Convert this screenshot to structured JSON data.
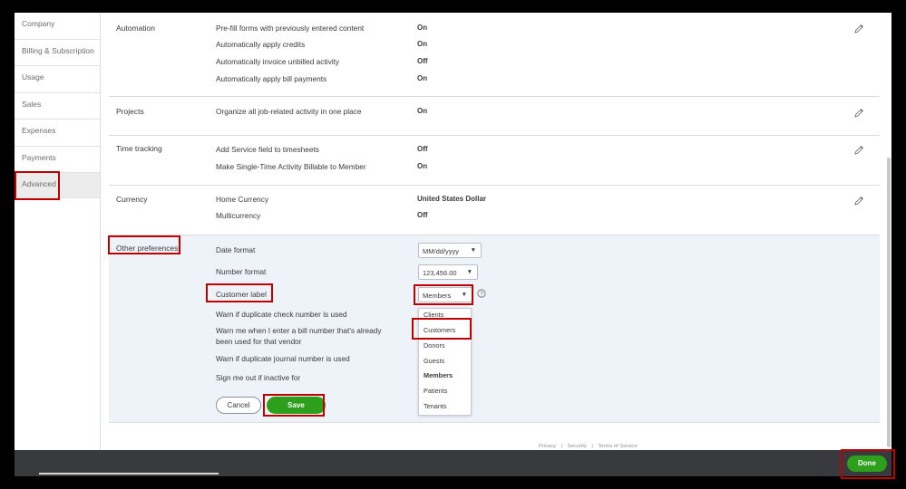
{
  "sidebar": {
    "items": [
      {
        "label": "Company"
      },
      {
        "label": "Billing & Subscription"
      },
      {
        "label": "Usage"
      },
      {
        "label": "Sales"
      },
      {
        "label": "Expenses"
      },
      {
        "label": "Payments"
      },
      {
        "label": "Advanced"
      }
    ],
    "active": "Advanced"
  },
  "sections": {
    "automation": {
      "label": "Automation",
      "rows": [
        {
          "label": "Pre-fill forms with previously entered content",
          "value": "On"
        },
        {
          "label": "Automatically apply credits",
          "value": "On"
        },
        {
          "label": "Automatically invoice unbilled activity",
          "value": "Off"
        },
        {
          "label": "Automatically apply bill payments",
          "value": "On"
        }
      ]
    },
    "projects": {
      "label": "Projects",
      "rows": [
        {
          "label": "Organize all job-related activity in one place",
          "value": "On"
        }
      ]
    },
    "time_tracking": {
      "label": "Time tracking",
      "rows": [
        {
          "label": "Add Service field to timesheets",
          "value": "Off"
        },
        {
          "label": "Make Single-Time Activity Billable to Member",
          "value": "On"
        }
      ]
    },
    "currency": {
      "label": "Currency",
      "rows": [
        {
          "label": "Home Currency",
          "value": "United States Dollar"
        },
        {
          "label": "Multicurrency",
          "value": "Off"
        }
      ]
    },
    "other": {
      "label": "Other preferences",
      "date_format_label": "Date format",
      "date_format_value": "MM/dd/yyyy",
      "number_format_label": "Number format",
      "number_format_value": "123,456.00",
      "customer_label_label": "Customer label",
      "customer_label_value": "Members",
      "warn_check": "Warn if duplicate check number is used",
      "warn_bill_line1": "Warn me when I enter a bill number that's already",
      "warn_bill_line2": "been used for that vendor",
      "warn_journal": "Warn if duplicate journal number is used",
      "sign_out": "Sign me out if inactive for",
      "dropdown_options": [
        "Clients",
        "Customers",
        "Donors",
        "Guests",
        "Members",
        "Patients",
        "Tenants"
      ],
      "cancel": "Cancel",
      "save": "Save"
    }
  },
  "footer": {
    "privacy": "Privacy",
    "security": "Security",
    "terms": "Terms of Service",
    "sep": "|"
  },
  "bottom": {
    "done": "Done"
  },
  "colors": {
    "accent_green": "#2ca01c",
    "highlight_red": "#c00000",
    "panel_blue": "#eef3f9",
    "bottom_bar": "#393a3d"
  }
}
